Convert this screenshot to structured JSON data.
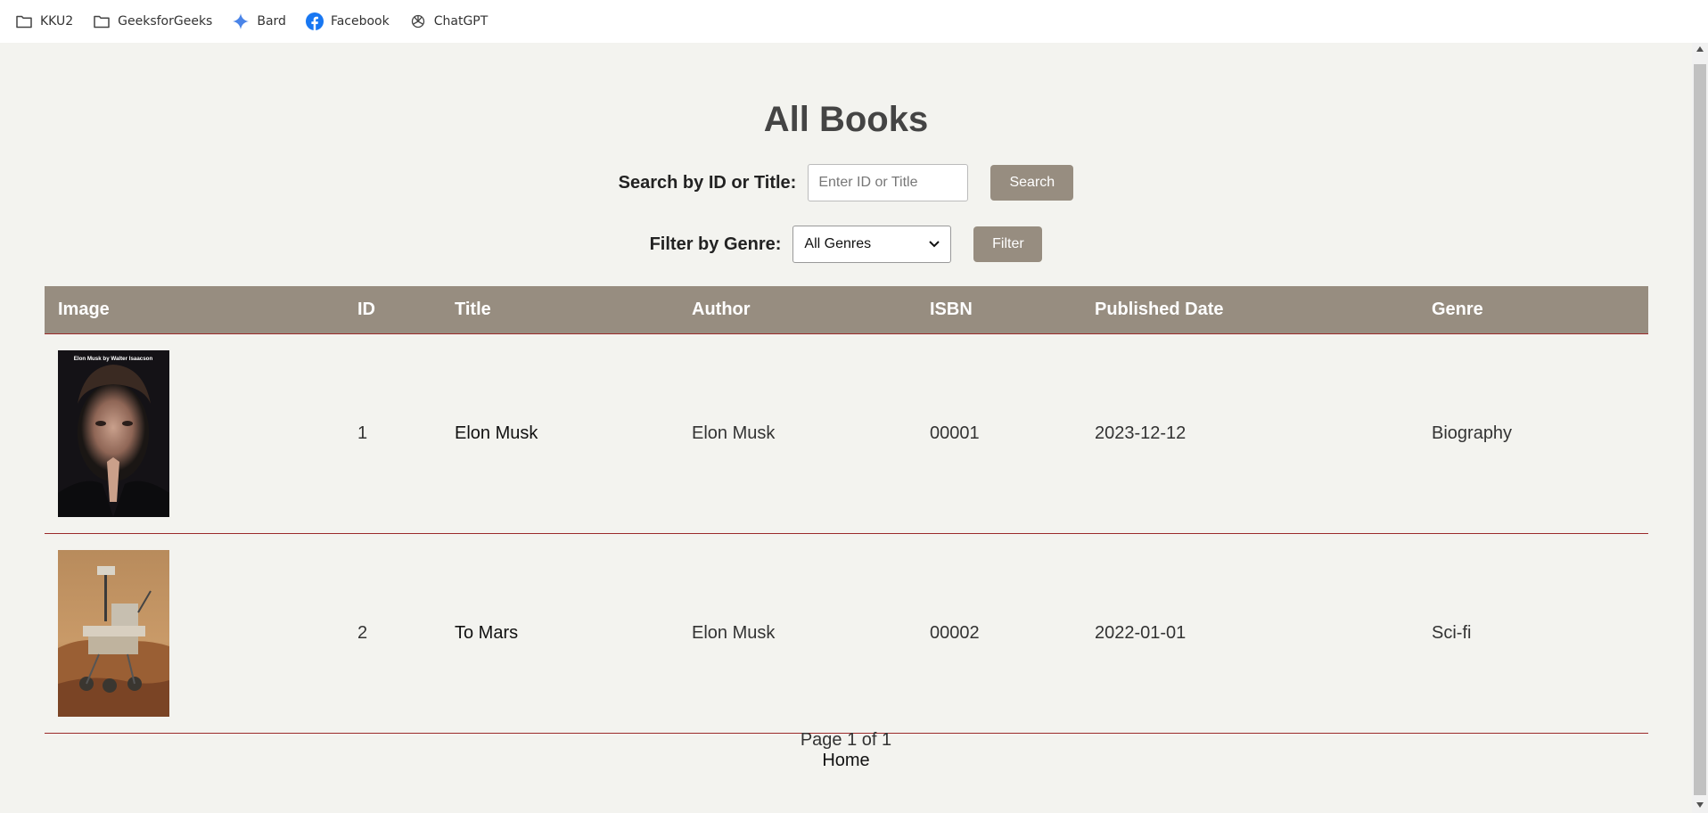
{
  "bookmarks": [
    {
      "label": "KKU2",
      "icon": "folder-icon"
    },
    {
      "label": "GeeksforGeeks",
      "icon": "folder-icon"
    },
    {
      "label": "Bard",
      "icon": "bard-sparkle-icon"
    },
    {
      "label": "Facebook",
      "icon": "facebook-icon"
    },
    {
      "label": "ChatGPT",
      "icon": "chatgpt-icon"
    }
  ],
  "page": {
    "title": "All Books",
    "search": {
      "label": "Search by ID or Title:",
      "placeholder": "Enter ID or Title",
      "value": "",
      "button": "Search"
    },
    "filter": {
      "label": "Filter by Genre:",
      "selected": "All Genres",
      "button": "Filter"
    }
  },
  "table": {
    "headers": [
      "Image",
      "ID",
      "Title",
      "Author",
      "ISBN",
      "Published Date",
      "Genre"
    ],
    "rows": [
      {
        "image": "cover-elon-musk-portrait",
        "id": "1",
        "title": "Elon Musk",
        "author": "Elon Musk",
        "isbn": "00001",
        "published": "2023-12-12",
        "genre": "Biography",
        "cover_text": "Elon Musk by Walter Isaacson"
      },
      {
        "image": "cover-mars-rover",
        "id": "2",
        "title": "To Mars",
        "author": "Elon Musk",
        "isbn": "00002",
        "published": "2022-01-01",
        "genre": "Sci-fi"
      }
    ]
  },
  "pagination": {
    "text": "Page 1 of 1"
  },
  "footer": {
    "home_link": "Home"
  },
  "colors": {
    "accent": "#978d80",
    "row_border": "#9b2a2a",
    "background": "#f3f3ef"
  }
}
